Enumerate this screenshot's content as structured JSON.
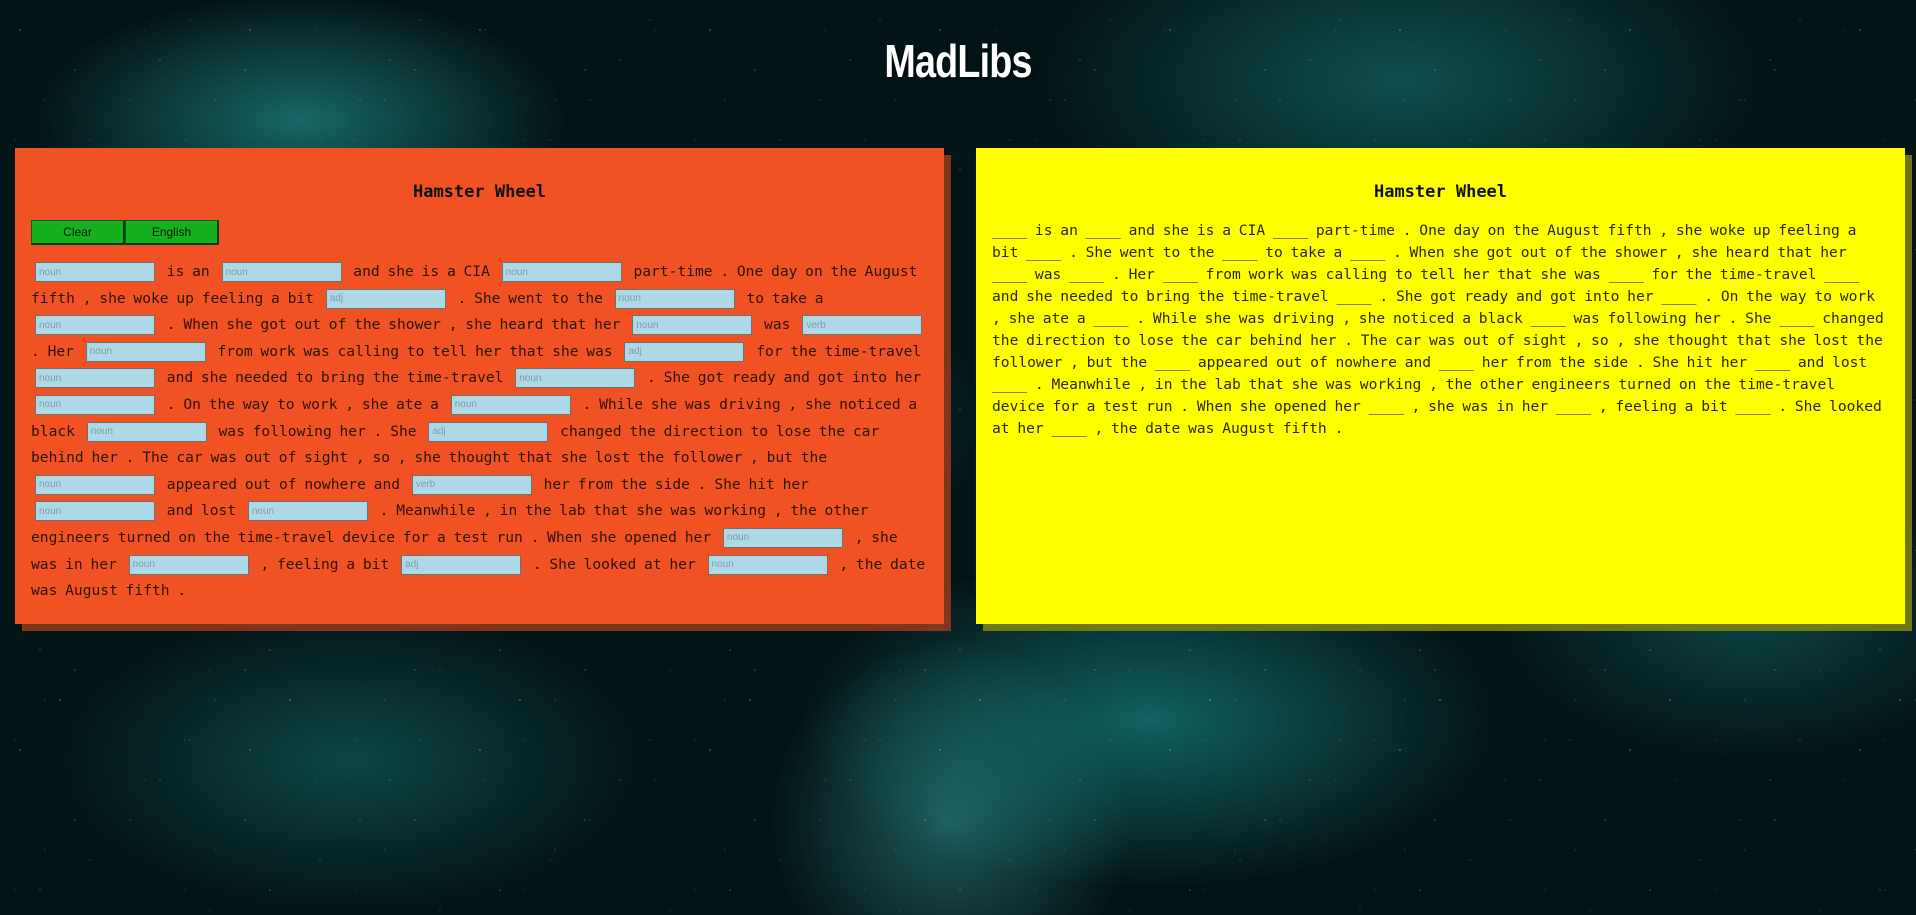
{
  "app_title": "MadLibs",
  "input_panel": {
    "title": "Hamster Wheel",
    "buttons": {
      "clear": "Clear",
      "language": "English"
    },
    "story": [
      {
        "blank": "noun"
      },
      {
        "text": " is an "
      },
      {
        "blank": "noun"
      },
      {
        "text": " and she is a CIA "
      },
      {
        "blank": "noun"
      },
      {
        "text": " part-time . One day on the August fifth , she woke up feeling a bit "
      },
      {
        "blank": "adj"
      },
      {
        "text": " . She went to the "
      },
      {
        "blank": "noun"
      },
      {
        "text": " to take a "
      },
      {
        "blank": "noun"
      },
      {
        "text": " . When she got out of the shower , she heard that her "
      },
      {
        "blank": "noun"
      },
      {
        "text": " was "
      },
      {
        "blank": "verb"
      },
      {
        "text": " . Her "
      },
      {
        "blank": "noun"
      },
      {
        "text": " from work was calling to tell her that she was "
      },
      {
        "blank": "adj"
      },
      {
        "text": " for the time-travel "
      },
      {
        "blank": "noun"
      },
      {
        "text": " and she needed to bring the time-travel "
      },
      {
        "blank": "noun"
      },
      {
        "text": " . She got ready and got into her "
      },
      {
        "blank": "noun"
      },
      {
        "text": " . On the way to work , she ate a "
      },
      {
        "blank": "noun"
      },
      {
        "text": " . While she was driving , she noticed a black "
      },
      {
        "blank": "noun"
      },
      {
        "text": " was following her . She "
      },
      {
        "blank": "adj"
      },
      {
        "text": " changed the direction to lose the car behind her . The car was out of sight , so , she thought that she lost the follower , but the "
      },
      {
        "blank": "noun"
      },
      {
        "text": " appeared out of nowhere and "
      },
      {
        "blank": "verb"
      },
      {
        "text": " her from the side . She hit her "
      },
      {
        "blank": "noun"
      },
      {
        "text": " and lost "
      },
      {
        "blank": "noun"
      },
      {
        "text": " . Meanwhile , in the lab that she was working , the other engineers turned on the time-travel device for a test run . When she opened her "
      },
      {
        "blank": "noun"
      },
      {
        "text": " , she was in her "
      },
      {
        "blank": "noun"
      },
      {
        "text": " , feeling a bit "
      },
      {
        "blank": "adj"
      },
      {
        "text": " . She looked at her "
      },
      {
        "blank": "noun"
      },
      {
        "text": " , the date was August fifth ."
      }
    ]
  },
  "output_panel": {
    "title": "Hamster Wheel",
    "story": "____ is an ____ and she is a CIA ____ part-time . One day on the August fifth , she woke up feeling a bit ____ . She went to the ____ to take a ____ . When she got out of the shower , she heard that her ____ was ____ . Her ____ from work was calling to tell her that she was ____ for the time-travel ____ and she needed to bring the time-travel ____ . She got ready and got into her ____ . On the way to work , she ate a ____ . While she was driving , she noticed a black ____ was following her . She ____ changed the direction to lose the car behind her . The car was out of sight , so , she thought that she lost the follower , but the ____ appeared out of nowhere and ____ her from the side . She hit her ____ and lost ____ . Meanwhile , in the lab that she was working , the other engineers turned on the time-travel device for a test run . When she opened her ____ , she was in her ____ , feeling a bit ____ . She looked at her ____ , the date was August fifth ."
  },
  "colors": {
    "input_panel_bg": "#f05224",
    "output_panel_bg": "#ffff00",
    "button_bg": "#14b01e",
    "blank_bg": "#add8e6"
  }
}
